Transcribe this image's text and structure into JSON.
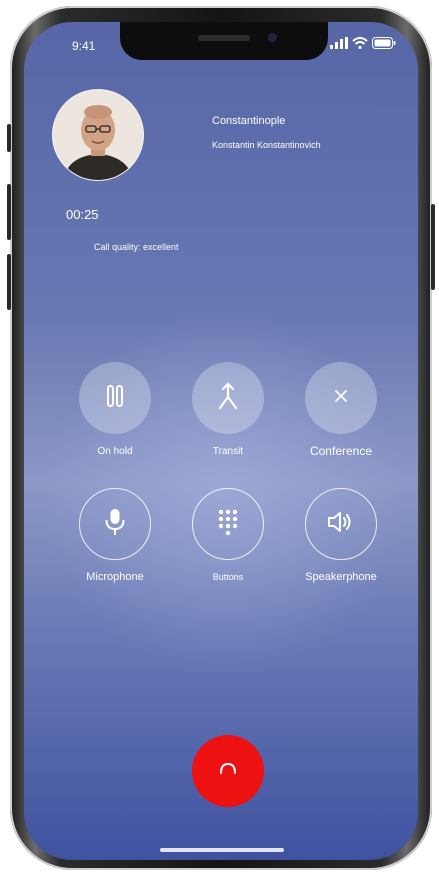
{
  "status_bar": {
    "time": "9:41"
  },
  "caller": {
    "name": "Constantinople",
    "full_name": "Konstantin Konstantinovich"
  },
  "call": {
    "timer": "00:25",
    "quality": "Call quality: excellent"
  },
  "controls": {
    "row1": [
      {
        "id": "hold",
        "label": "On hold",
        "icon": "pause-icon"
      },
      {
        "id": "transit",
        "label": "Transit",
        "icon": "merge-arrow-icon"
      },
      {
        "id": "conference",
        "label": "Conference",
        "icon": "close-icon"
      }
    ],
    "row2": [
      {
        "id": "microphone",
        "label": "Microphone",
        "icon": "microphone-icon"
      },
      {
        "id": "buttons",
        "label": "Buttons",
        "icon": "keypad-icon"
      },
      {
        "id": "speakerphone",
        "label": "Speakerphone",
        "icon": "speaker-icon"
      }
    ]
  },
  "colors": {
    "end_call": "#ee1111",
    "screen_top": "#5666a6",
    "screen_bottom": "#3f52a0"
  }
}
